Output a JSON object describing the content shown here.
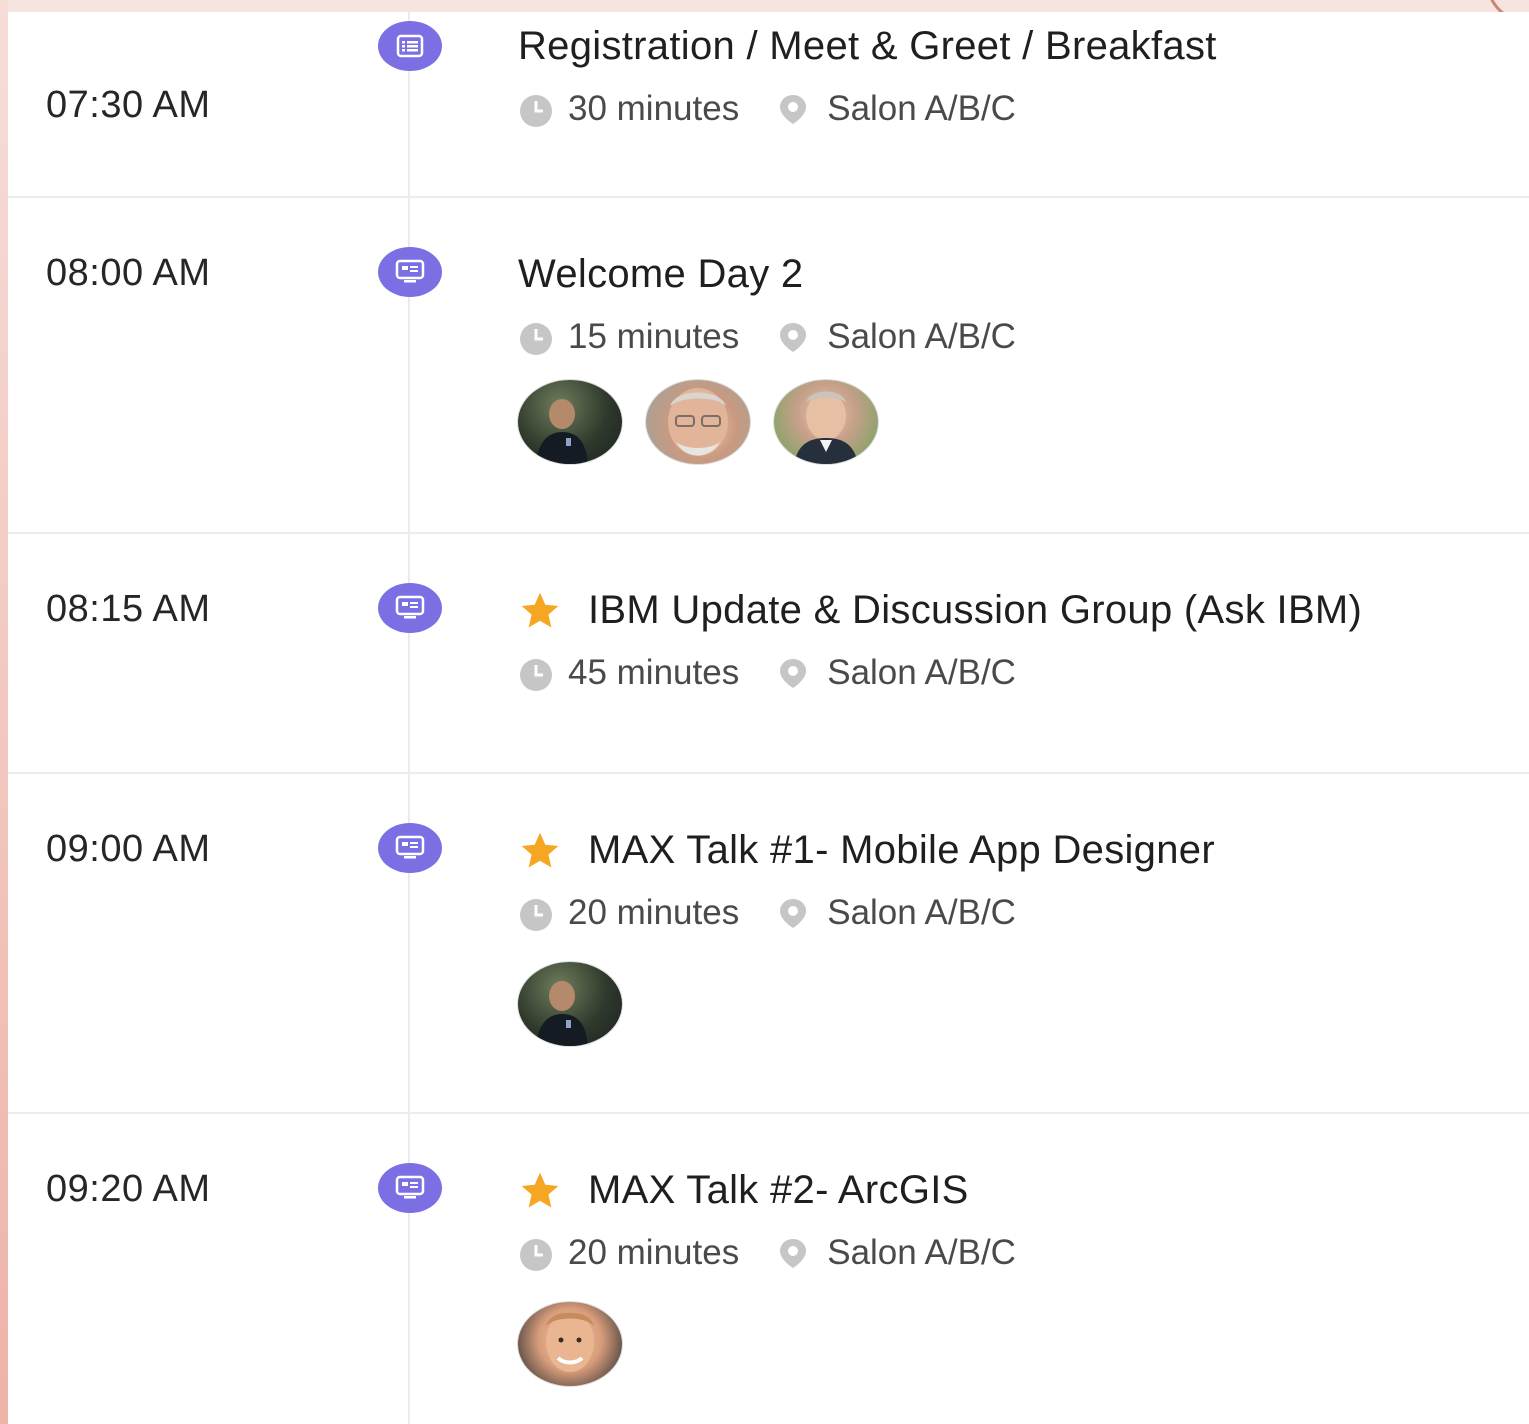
{
  "colors": {
    "type_icon": "#7b6fe3",
    "star": "#f5a623",
    "meta_icon": "#c6c6c6",
    "divider": "#ececec"
  },
  "schedule": [
    {
      "time": "07:30 AM",
      "type_icon": "list-icon",
      "starred": false,
      "title": "Registration / Meet & Greet / Breakfast",
      "duration": "30 minutes",
      "location": "Salon A/B/C",
      "speakers": []
    },
    {
      "time": "08:00 AM",
      "type_icon": "presentation-icon",
      "starred": false,
      "title": "Welcome Day 2",
      "duration": "15 minutes",
      "location": "Salon A/B/C",
      "speakers": [
        "avatar-photo",
        "avatar-photo",
        "avatar-photo"
      ]
    },
    {
      "time": "08:15 AM",
      "type_icon": "presentation-icon",
      "starred": true,
      "title": "IBM Update & Discussion Group (Ask IBM)",
      "duration": "45 minutes",
      "location": "Salon A/B/C",
      "speakers": []
    },
    {
      "time": "09:00 AM",
      "type_icon": "presentation-icon",
      "starred": true,
      "title": "MAX Talk #1- Mobile App Designer",
      "duration": "20 minutes",
      "location": "Salon A/B/C",
      "speakers": [
        "avatar-photo"
      ]
    },
    {
      "time": "09:20 AM",
      "type_icon": "presentation-icon",
      "starred": true,
      "title": "MAX Talk #2- ArcGIS",
      "duration": "20 minutes",
      "location": "Salon A/B/C",
      "speakers": [
        "avatar-photo"
      ]
    }
  ]
}
